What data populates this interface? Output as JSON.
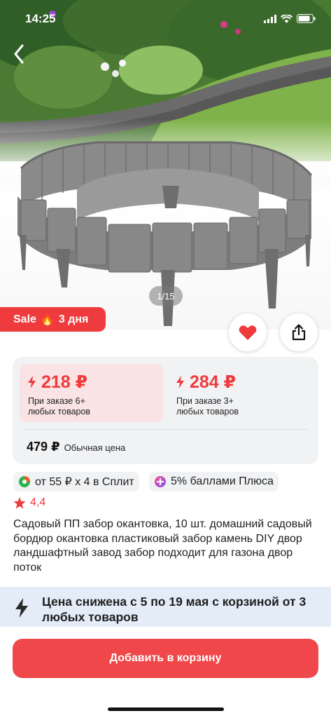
{
  "status_bar": {
    "time": "14:25"
  },
  "gallery": {
    "counter": "1/15"
  },
  "sale_badge": {
    "label": "Sale",
    "emoji": "🔥",
    "days": "3 дня"
  },
  "prices": {
    "option1": {
      "value": "218 ₽",
      "note": "При заказе 6+ любых товаров"
    },
    "option2": {
      "value": "284 ₽",
      "note": "При заказе 3+ любых товаров"
    },
    "regular": {
      "value": "479 ₽",
      "label": "Обычная цена"
    }
  },
  "chips": {
    "split": "от 55 ₽ x 4 в Сплит",
    "plus": "5% баллами Плюса"
  },
  "rating": {
    "value": "4,4"
  },
  "product": {
    "title": "Садовый ПП забор окантовка, 10 шт. домашний садовый бордюр окантовка пластиковый забор камень DIY двор ландшафтный завод забор подходит для газона двор поток"
  },
  "promo": {
    "text": "Цена снижена с 5 по 19 мая с корзиной от 3 любых товаров"
  },
  "cart_button": {
    "label": "Добавить в корзину"
  },
  "colors": {
    "accent": "#ef3b3e",
    "button": "#f0474a",
    "promo_bg": "#e4ecf8",
    "card_bg": "#f1f2f4"
  }
}
